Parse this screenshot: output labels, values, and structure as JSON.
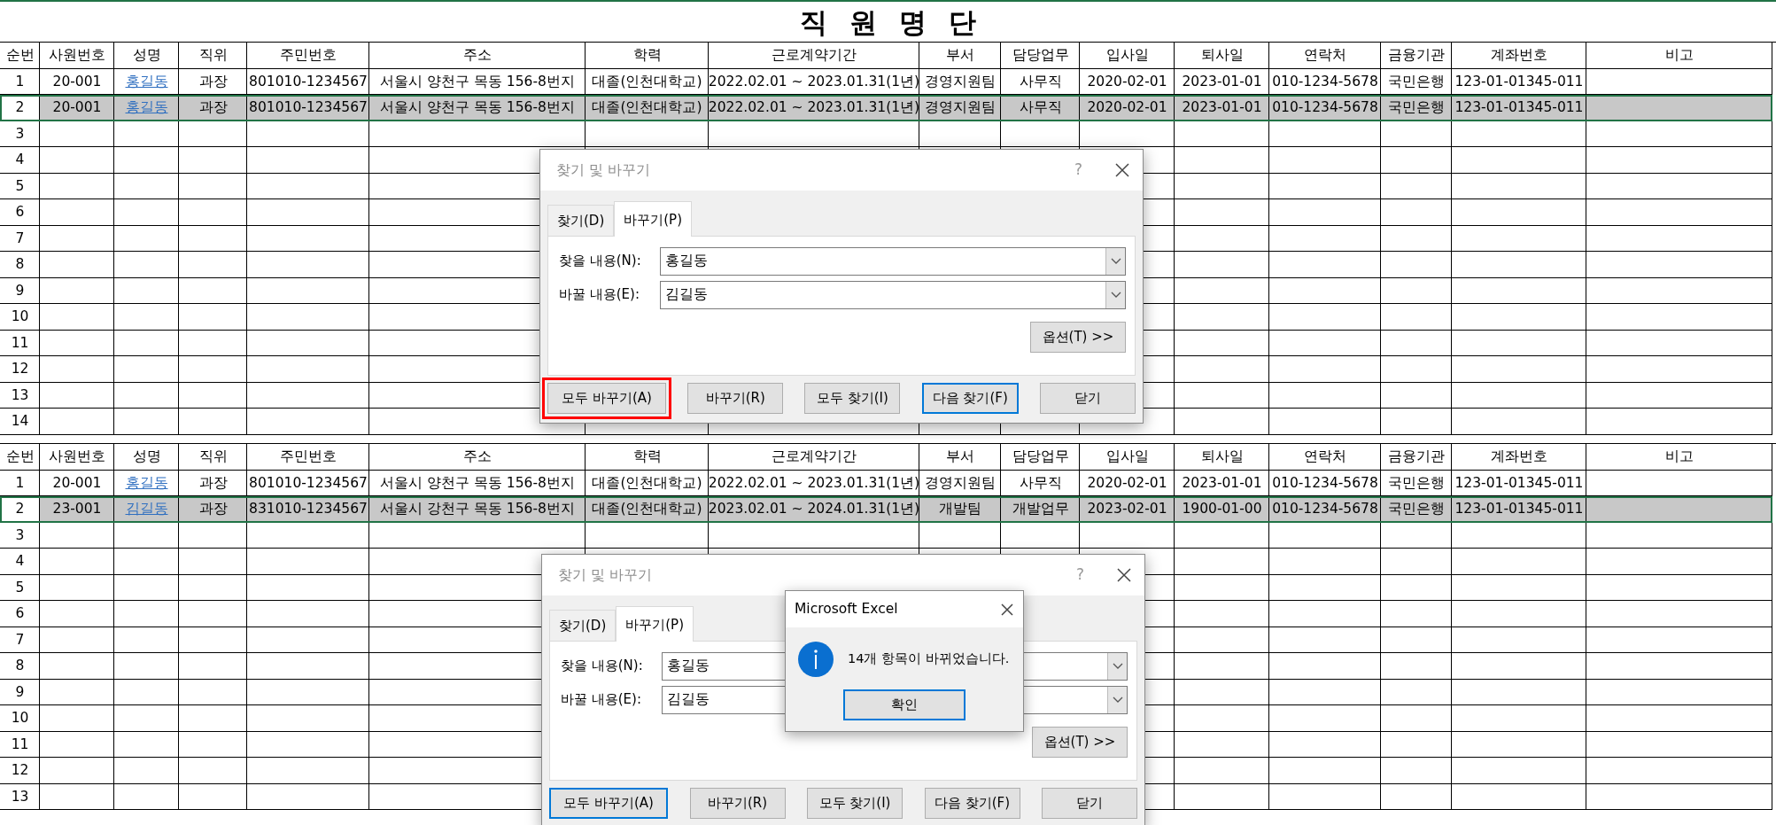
{
  "sheets": [
    {
      "title": "직 원 명 단",
      "columns": [
        "순번",
        "사원번호",
        "성명",
        "직위",
        "주민번호",
        "주소",
        "학력",
        "근로계약기간",
        "부서",
        "담당업무",
        "입사일",
        "퇴사일",
        "연락처",
        "금융기관",
        "계좌번호",
        "비고"
      ],
      "rows": [
        {
          "selected": false,
          "cells": [
            "1",
            "20-001",
            {
              "link": "홍길동"
            },
            "과장",
            "801010-1234567",
            "서울시 양천구 목동 156-8번지",
            "대졸(인천대학교)",
            "2022.02.01 ~ 2023.01.31(1년)",
            "경영지원팀",
            "사무직",
            "2020-02-01",
            "2023-01-01",
            "010-1234-5678",
            "국민은행",
            "123-01-01345-011"
          ]
        },
        {
          "selected": true,
          "cells": [
            "2",
            "20-001",
            {
              "link": "홍길동"
            },
            "과장",
            "801010-1234567",
            "서울시 양천구 목동 156-8번지",
            "대졸(인천대학교)",
            "2022.02.01 ~ 2023.01.31(1년)",
            "경영지원팀",
            "사무직",
            "2020-02-01",
            "2023-01-01",
            "010-1234-5678",
            "국민은행",
            "123-01-01345-011"
          ]
        },
        {
          "selected": false,
          "cells": [
            "3"
          ]
        },
        {
          "selected": false,
          "cells": [
            "4"
          ]
        },
        {
          "selected": false,
          "cells": [
            "5"
          ]
        },
        {
          "selected": false,
          "cells": [
            "6"
          ]
        },
        {
          "selected": false,
          "cells": [
            "7"
          ]
        },
        {
          "selected": false,
          "cells": [
            "8"
          ]
        },
        {
          "selected": false,
          "cells": [
            "9"
          ]
        },
        {
          "selected": false,
          "cells": [
            "10"
          ]
        },
        {
          "selected": false,
          "cells": [
            "11"
          ]
        },
        {
          "selected": false,
          "cells": [
            "12"
          ]
        },
        {
          "selected": false,
          "cells": [
            "13"
          ]
        },
        {
          "selected": false,
          "cells": [
            "14"
          ]
        }
      ],
      "dialog": {
        "title": "찾기 및 바꾸기",
        "help": "?",
        "tabs": [
          {
            "label": "찾기(D)",
            "selected": false
          },
          {
            "label": "바꾸기(P)",
            "selected": true
          }
        ],
        "fields": [
          {
            "label": "찾을 내용(N):",
            "value": "홍길동"
          },
          {
            "label": "바꿀 내용(E):",
            "value": "김길동"
          }
        ],
        "options_button": "옵션(T) >>",
        "buttons": [
          {
            "label": "모두 바꾸기(A)",
            "focused": false,
            "annotated": true
          },
          {
            "label": "바꾸기(R)",
            "focused": false,
            "annotated": false
          },
          {
            "label": "모두 찾기(I)",
            "focused": false,
            "annotated": false
          },
          {
            "label": "다음 찾기(F)",
            "focused": true,
            "annotated": false
          },
          {
            "label": "닫기",
            "focused": false,
            "annotated": false
          }
        ]
      }
    },
    {
      "columns": [
        "순번",
        "사원번호",
        "성명",
        "직위",
        "주민번호",
        "주소",
        "학력",
        "근로계약기간",
        "부서",
        "담당업무",
        "입사일",
        "퇴사일",
        "연락처",
        "금융기관",
        "계좌번호",
        "비고"
      ],
      "rows": [
        {
          "selected": false,
          "cells": [
            "1",
            "20-001",
            {
              "link": "홍길동"
            },
            "과장",
            "801010-1234567",
            "서울시 양천구 목동 156-8번지",
            "대졸(인천대학교)",
            "2022.02.01 ~ 2023.01.31(1년)",
            "경영지원팀",
            "사무직",
            "2020-02-01",
            "2023-01-01",
            "010-1234-5678",
            "국민은행",
            "123-01-01345-011"
          ]
        },
        {
          "selected": true,
          "cells": [
            "2",
            "23-001",
            {
              "link": "김길동"
            },
            "과장",
            "831010-1234567",
            "서울시 강천구 목동 156-8번지",
            "대졸(인천대학교)",
            "2023.02.01 ~ 2024.01.31(1년)",
            "개발팀",
            "개발업무",
            "2023-02-01",
            "1900-01-00",
            "010-1234-5678",
            "국민은행",
            "123-01-01345-011"
          ]
        },
        {
          "selected": false,
          "cells": [
            "3"
          ]
        },
        {
          "selected": false,
          "cells": [
            "4"
          ]
        },
        {
          "selected": false,
          "cells": [
            "5"
          ]
        },
        {
          "selected": false,
          "cells": [
            "6"
          ]
        },
        {
          "selected": false,
          "cells": [
            "7"
          ]
        },
        {
          "selected": false,
          "cells": [
            "8"
          ]
        },
        {
          "selected": false,
          "cells": [
            "9"
          ]
        },
        {
          "selected": false,
          "cells": [
            "10"
          ]
        },
        {
          "selected": false,
          "cells": [
            "11"
          ]
        },
        {
          "selected": false,
          "cells": [
            "12"
          ]
        },
        {
          "selected": false,
          "cells": [
            "13"
          ]
        }
      ],
      "dialog": {
        "title": "찾기 및 바꾸기",
        "help": "?",
        "tabs": [
          {
            "label": "찾기(D)",
            "selected": false
          },
          {
            "label": "바꾸기(P)",
            "selected": true
          }
        ],
        "fields": [
          {
            "label": "찾을 내용(N):",
            "value": "홍길동"
          },
          {
            "label": "바꿀 내용(E):",
            "value": "김길동"
          }
        ],
        "options_button": "옵션(T) >>",
        "buttons": [
          {
            "label": "모두 바꾸기(A)",
            "focused": true,
            "annotated": false
          },
          {
            "label": "바꾸기(R)",
            "focused": false,
            "annotated": false
          },
          {
            "label": "모두 찾기(I)",
            "focused": false,
            "annotated": false
          },
          {
            "label": "다음 찾기(F)",
            "focused": false,
            "annotated": false
          },
          {
            "label": "닫기",
            "focused": false,
            "annotated": false
          }
        ],
        "message_box": {
          "title": "Microsoft Excel",
          "message": "14개 항목이 바뀌었습니다.",
          "button": "확인"
        }
      }
    }
  ]
}
